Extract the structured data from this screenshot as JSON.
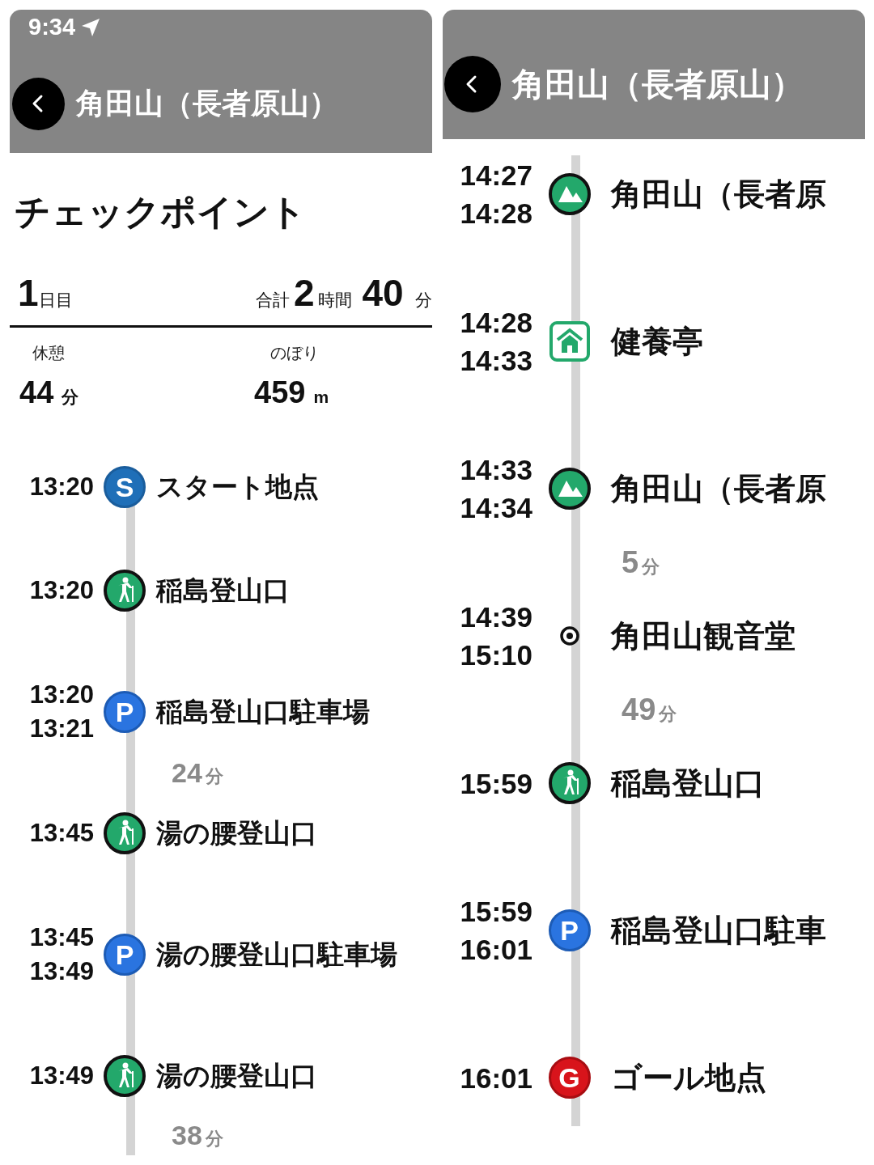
{
  "panels": [
    {
      "status_time": "9:34",
      "title": "角田山（長者原山）",
      "heading": "チェックポイント",
      "summary": {
        "day_number": "1",
        "day_unit": "日目",
        "total_label": "合計",
        "hours": "2",
        "hours_unit": "時間",
        "minutes": "40",
        "minutes_unit": "分",
        "stats": [
          {
            "label": "休憩",
            "value": "44",
            "unit": "分"
          },
          {
            "label": "のぼり",
            "value": "459",
            "unit": "m"
          }
        ]
      },
      "timeline": [
        {
          "kind": "start",
          "badge": "S",
          "times": [
            "13:20"
          ],
          "name": "スタート地点"
        },
        {
          "kind": "trailhead",
          "times": [
            "13:20"
          ],
          "name": "稲島登山口"
        },
        {
          "kind": "parking",
          "badge": "P",
          "times": [
            "13:20",
            "13:21"
          ],
          "name": "稲島登山口駐車場"
        },
        {
          "kind": "duration",
          "value": "24",
          "unit": "分"
        },
        {
          "kind": "trailhead",
          "times": [
            "13:45"
          ],
          "name": "湯の腰登山口"
        },
        {
          "kind": "parking",
          "badge": "P",
          "times": [
            "13:45",
            "13:49"
          ],
          "name": "湯の腰登山口駐車場"
        },
        {
          "kind": "trailhead",
          "times": [
            "13:49"
          ],
          "name": "湯の腰登山口"
        },
        {
          "kind": "duration",
          "value": "38",
          "unit": "分"
        }
      ]
    },
    {
      "title": "角田山（長者原山）",
      "timeline": [
        {
          "kind": "summit",
          "times": [
            "14:27",
            "14:28"
          ],
          "name": "角田山（長者原"
        },
        {
          "kind": "hut",
          "times": [
            "14:28",
            "14:33"
          ],
          "name": "健養亭"
        },
        {
          "kind": "summit",
          "times": [
            "14:33",
            "14:34"
          ],
          "name": "角田山（長者原"
        },
        {
          "kind": "duration",
          "value": "5",
          "unit": "分"
        },
        {
          "kind": "poi",
          "times": [
            "14:39",
            "15:10"
          ],
          "name": "角田山観音堂"
        },
        {
          "kind": "duration",
          "value": "49",
          "unit": "分"
        },
        {
          "kind": "trailhead",
          "times": [
            "15:59"
          ],
          "name": "稲島登山口"
        },
        {
          "kind": "parking",
          "badge": "P",
          "times": [
            "15:59",
            "16:01"
          ],
          "name": "稲島登山口駐車"
        },
        {
          "kind": "goal",
          "badge": "G",
          "times": [
            "16:01"
          ],
          "name": "ゴール地点"
        }
      ]
    }
  ]
}
